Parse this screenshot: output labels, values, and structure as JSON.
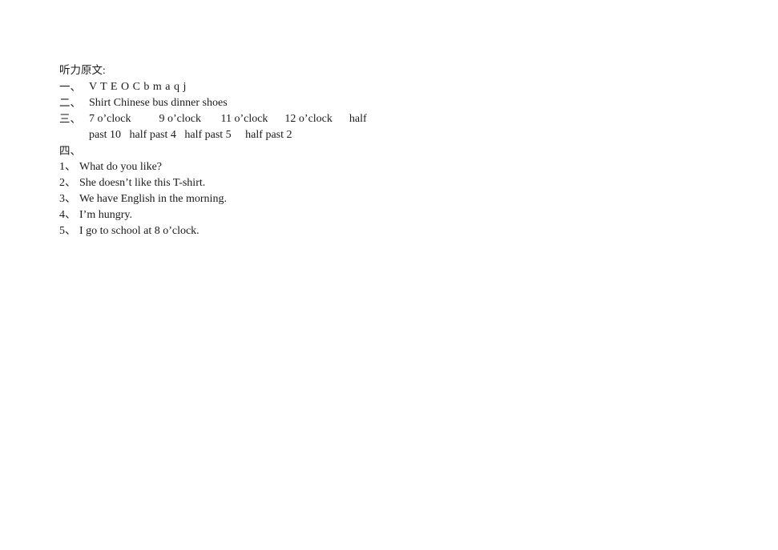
{
  "document": {
    "heading": "听力原文:",
    "sections": [
      {
        "marker": "一、",
        "lines": [
          "V T E O C b m a q j"
        ]
      },
      {
        "marker": "二、",
        "lines": [
          "Shirt Chinese bus dinner shoes"
        ]
      },
      {
        "marker": "三、",
        "lines": [
          "7 o’clock          9 o’clock       11 o’clock      12 o’clock      half",
          "past 10   half past 4   half past 5     half past 2"
        ]
      },
      {
        "marker": "四、",
        "lines": [
          ""
        ]
      }
    ],
    "questions": [
      {
        "marker": "1、",
        "text": "What do you like?"
      },
      {
        "marker": "2、",
        "text": "She doesn’t like this T-shirt."
      },
      {
        "marker": "3、",
        "text": "We have English in the morning."
      },
      {
        "marker": "4、",
        "text": "I’m hungry."
      },
      {
        "marker": "5、",
        "text": "I go to school at 8 o’clock."
      }
    ]
  }
}
